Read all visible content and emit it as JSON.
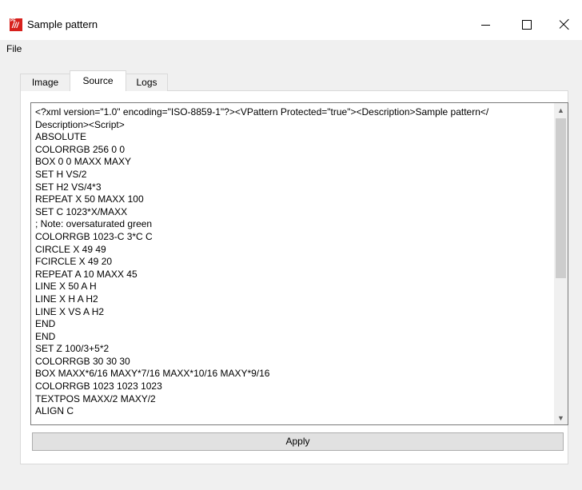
{
  "window": {
    "title": "Sample pattern",
    "icon": "app-logo-icon",
    "icon_tag": "PE",
    "icon_mark": "///",
    "controls": {
      "minimize": "minimize-icon",
      "maximize": "maximize-icon",
      "close": "close-icon"
    }
  },
  "menu": {
    "file": "File"
  },
  "tabs": [
    {
      "label": "Image",
      "active": false
    },
    {
      "label": "Source",
      "active": true
    },
    {
      "label": "Logs",
      "active": false
    }
  ],
  "source": {
    "lines": [
      "<?xml version=\"1.0\" encoding=\"ISO-8859-1\"?><VPattern Protected=\"true\"><Description>Sample pattern</",
      "Description><Script>",
      "ABSOLUTE",
      "COLORRGB 256 0 0",
      "BOX 0 0 MAXX MAXY",
      "SET H VS/2",
      "SET H2 VS/4*3",
      "REPEAT X 50 MAXX 100",
      "SET C 1023*X/MAXX",
      "; Note: oversaturated green",
      "COLORRGB 1023-C 3*C C",
      "CIRCLE X 49 49",
      "FCIRCLE X 49 20",
      "REPEAT A 10 MAXX 45",
      "LINE X 50 A H",
      "LINE X H A H2",
      "LINE X VS A H2",
      "END",
      "END",
      "SET Z 100/3+5*2",
      "COLORRGB 30 30 30",
      "BOX MAXX*6/16 MAXY*7/16 MAXX*10/16 MAXY*9/16",
      "COLORRGB 1023 1023 1023",
      "TEXTPOS MAXX/2 MAXY/2",
      "ALIGN C"
    ],
    "scroll": {
      "up_icon": "scroll-up-icon",
      "down_icon": "scroll-down-icon"
    }
  },
  "actions": {
    "apply": "Apply"
  },
  "colors": {
    "title_bg": "#ffffff",
    "window_bg": "#f0f0f0",
    "icon_red": "#d7201c",
    "button_bg": "#e1e1e1"
  }
}
